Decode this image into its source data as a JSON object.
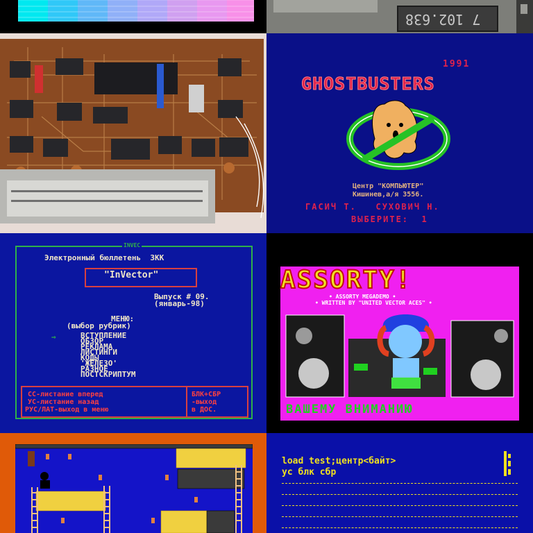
{
  "chip": {
    "code": "7 102.638"
  },
  "ghostbusters": {
    "year": "1991",
    "title": "GHOSTBUSTERS",
    "center": "Центр \"КОМПЬЮТЕР\"",
    "address": "Кишинев,а/я 3556.",
    "authors": "ГАСИЧ Т.   СУХОВИЧ Н.",
    "choose": "ВЫБЕРИТЕ:  1"
  },
  "invector": {
    "header": "INVEC",
    "bulletin": "Электронный бюллетень  ЗКК",
    "logo": "\"InVector\"",
    "issue": "Выпуск # 09.",
    "date": "(январь-98)",
    "menu_title": "МЕНЮ:",
    "menu_subtitle": "(выбор рубрик)",
    "arrow": "⇒",
    "menu_items": [
      "ВСТУПЛЕНИЕ",
      "ОБЗОР",
      "РЕКЛАМА",
      "ЛИСТИНГИ",
      "КОДЫ",
      "'ЖЕЛЕЗО'",
      "РАЗНОЕ",
      "ПОСТСКРИПТУМ"
    ],
    "help_left_1": "СС-листание вперед",
    "help_left_2": "УС-листание назад",
    "help_left_3": "РУС/ЛАТ-выход в меню",
    "help_right_1": "БЛК+СБР",
    "help_right_2": "-выход",
    "help_right_3": "в ДОС."
  },
  "assorty": {
    "title": "ASSORTY!",
    "subtitle1": "• ASSORTY MEGADEMO •",
    "subtitle2": "• WRITTEN BY \"UNITED VECTOR ACES\" •",
    "bottom": "ВАШЕМУ ВНИМАНИЮ"
  },
  "command_screen": {
    "line1": "load test;центр<байт>",
    "line2": "ус блк сбр"
  },
  "colors": {
    "vector_blue": "#0a10a8",
    "vector_red": "#e0224c",
    "vector_green": "#2fb04a",
    "vector_yellow": "#f0e020",
    "vector_magenta": "#f020f0"
  }
}
